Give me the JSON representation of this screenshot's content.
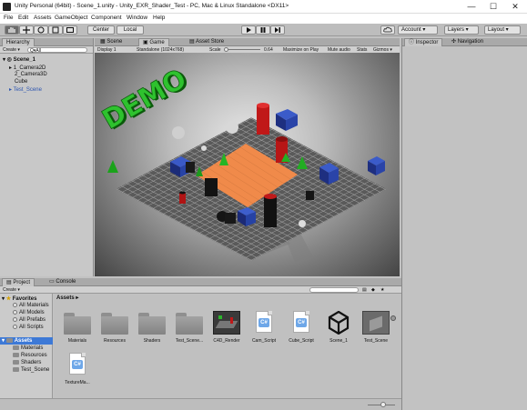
{
  "window": {
    "title": "Unity Personal (64bit) - Scene_1.unity - Unity_EXR_Shader_Test - PC, Mac & Linux Standalone <DX11>",
    "minimize": "—",
    "maximize": "☐",
    "close": "✕"
  },
  "menu": [
    "File",
    "Edit",
    "Assets",
    "GameObject",
    "Component",
    "Window",
    "Help"
  ],
  "toolbar": {
    "pivot": "Center",
    "space": "Local",
    "account": "Account",
    "layers": "Layers",
    "layout": "Layout"
  },
  "hierarchy": {
    "tab": "Hierarchy",
    "create": "Create ▾",
    "search_placeholder": "Q▾All",
    "scene": "Scene_1",
    "items": [
      "1_Camera2D",
      "2_Camera3D",
      "Cube",
      "Test_Scene"
    ]
  },
  "scene_tabs": {
    "scene": "Scene",
    "game": "Game",
    "asset_store": "Asset Store"
  },
  "game_bar": {
    "display": "Display 1",
    "resolution": "Standalone (1024x768)",
    "scale_label": "Scale",
    "scale_value": "0.64",
    "maximize": "Maximize on Play",
    "mute": "Mute audio",
    "stats": "Stats",
    "gizmos": "Gizmos ▾"
  },
  "scene_text": "DEMO",
  "inspector": {
    "tab_inspector": "Inspector",
    "tab_navigation": "Navigation"
  },
  "project": {
    "tab_project": "Project",
    "tab_console": "Console",
    "create": "Create ▾",
    "breadcrumb": "Assets ▸",
    "favorites_label": "Favorites",
    "favorites": [
      "All Materials",
      "All Models",
      "All Prefabs",
      "All Scripts"
    ],
    "assets_label": "Assets",
    "folders": [
      "Materials",
      "Resources",
      "Shaders",
      "Test_Scene"
    ]
  },
  "assets": [
    {
      "name": "Materials",
      "kind": "folder"
    },
    {
      "name": "Resources",
      "kind": "folder"
    },
    {
      "name": "Shaders",
      "kind": "folder"
    },
    {
      "name": "Test_Scene...",
      "kind": "folder"
    },
    {
      "name": "C4D_Render",
      "kind": "image"
    },
    {
      "name": "Cam_Script",
      "kind": "script"
    },
    {
      "name": "Cube_Script",
      "kind": "script"
    },
    {
      "name": "Scene_1",
      "kind": "unity"
    },
    {
      "name": "Test_Scene",
      "kind": "prefab"
    },
    {
      "name": "TextureMa...",
      "kind": "script"
    }
  ]
}
